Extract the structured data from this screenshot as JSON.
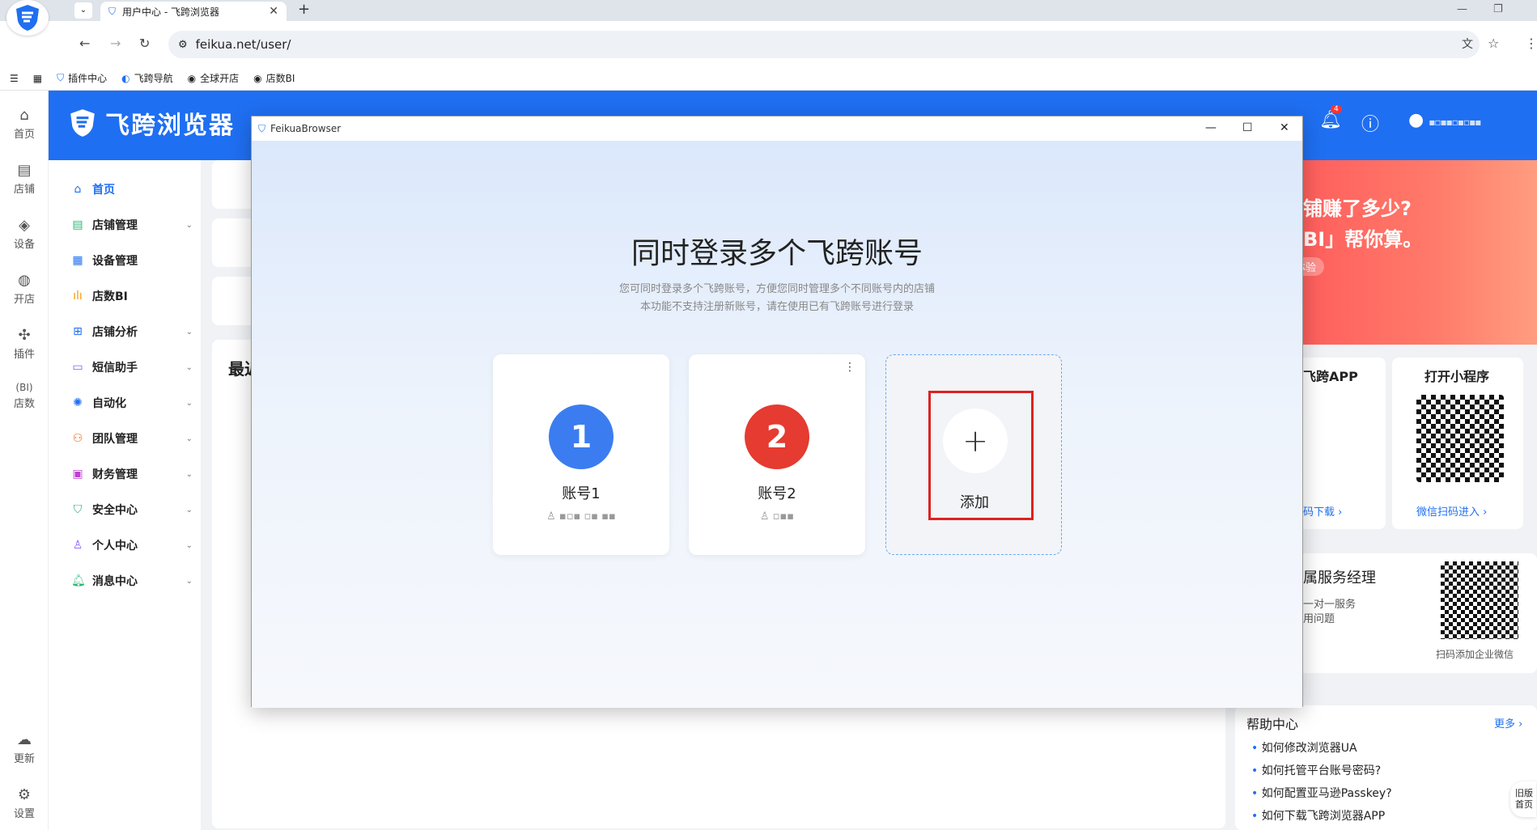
{
  "browser": {
    "tab_title": "用户中心 - 飞跨浏览器",
    "url": "feikua.net/user/",
    "bookmarks": [
      "插件中心",
      "飞跨导航",
      "全球开店",
      "店数BI"
    ]
  },
  "rail": {
    "items": [
      "首页",
      "店铺",
      "设备",
      "开店",
      "插件",
      "店数"
    ],
    "bottom": [
      "更新",
      "设置"
    ]
  },
  "header": {
    "brand": "飞跨浏览器",
    "notif_count": "4"
  },
  "sidenav": {
    "items": [
      {
        "label": "首页",
        "icon": "home-icon"
      },
      {
        "label": "店铺管理",
        "icon": "shop-icon"
      },
      {
        "label": "设备管理",
        "icon": "device-icon"
      },
      {
        "label": "店数BI",
        "icon": "bi-chart-icon"
      },
      {
        "label": "店铺分析",
        "icon": "grid-icon"
      },
      {
        "label": "短信助手",
        "icon": "message-icon"
      },
      {
        "label": "自动化",
        "icon": "sun-icon"
      },
      {
        "label": "团队管理",
        "icon": "team-icon"
      },
      {
        "label": "财务管理",
        "icon": "wallet-icon"
      },
      {
        "label": "安全中心",
        "icon": "shield-icon"
      },
      {
        "label": "个人中心",
        "icon": "user-icon"
      },
      {
        "label": "消息中心",
        "icon": "bell-icon"
      }
    ]
  },
  "background": {
    "section_title": "最近",
    "promo_line1": "店铺赚了多少?",
    "promo_line2": "「BI」帮你算。",
    "promo_button": "体验",
    "app_title": "飞跨APP",
    "app_link": "码下载 ›",
    "mini_title": "打开小程序",
    "mini_link": "微信扫码进入 ›",
    "service_title": "属服务经理",
    "service_line1": "一对一服务",
    "service_line2": "用问题",
    "wechat_caption": "扫码添加企业微信",
    "help_title": "帮助中心",
    "help_more": "更多 ›",
    "help_items": [
      "如何修改浏览器UA",
      "如何托管平台账号密码?",
      "如何配置亚马逊Passkey?",
      "如何下载飞跨浏览器APP"
    ],
    "old_home": "旧版首页"
  },
  "modal": {
    "window_title": "FeikuaBrowser",
    "heading": "同时登录多个飞跨账号",
    "sub1": "您可同时登录多个飞跨账号，方便您同时管理多个不同账号内的店铺",
    "sub2": "本功能不支持注册新账号，请在使用已有飞跨账号进行登录",
    "accounts": [
      {
        "number": "1",
        "name": "账号1",
        "color": "#3b7df0"
      },
      {
        "number": "2",
        "name": "账号2",
        "color": "#e53b30"
      }
    ],
    "add_label": "添加"
  }
}
